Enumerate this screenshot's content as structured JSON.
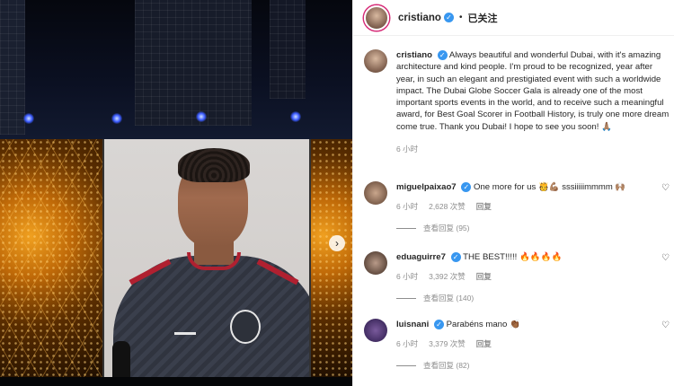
{
  "post": {
    "author": "cristiano",
    "follow_label": "已关注",
    "caption": "Always beautiful and wonderful Dubai, with it's amazing architecture and kind people. I'm proud to be recognized, year after year, in such an elegant and prestigiated event with such a worldwide impact. The Dubai Globe Soccer Gala is already one of the most important sports events in the world, and to receive such a meaningful award, for Best Goal Scorer in Football History, is truly one more dream come true. Thank you Dubai! I hope to see you soon!",
    "caption_emoji": "🙏🏽",
    "time": "6 小时"
  },
  "comments": [
    {
      "user": "miguelpaixao7",
      "text": "One more for us",
      "emoji": "🫅💪🏽 sssiiiiimmmm 🙌🏽",
      "time": "6 小时",
      "likes": "2,628 次赞",
      "reply_label": "回复",
      "view_replies": "查看回复 (95)"
    },
    {
      "user": "eduaguirre7",
      "text": "THE BEST!!!!!",
      "emoji": "🔥🔥🔥🔥",
      "time": "6 小时",
      "likes": "3,392 次赞",
      "reply_label": "回复",
      "view_replies": "查看回复 (140)"
    },
    {
      "user": "luisnani",
      "text": "Parabéns mano",
      "emoji": "👏🏾",
      "time": "6 小时",
      "likes": "3,379 次赞",
      "reply_label": "回复",
      "view_replies": "查看回复 (82)"
    }
  ],
  "icons": {
    "verified": "verified-badge-icon",
    "heart": "heart-outline-icon",
    "next": "chevron-right-icon"
  },
  "colors": {
    "verified": "#3897f0",
    "muted": "#8e8e8e",
    "text": "#262626"
  }
}
